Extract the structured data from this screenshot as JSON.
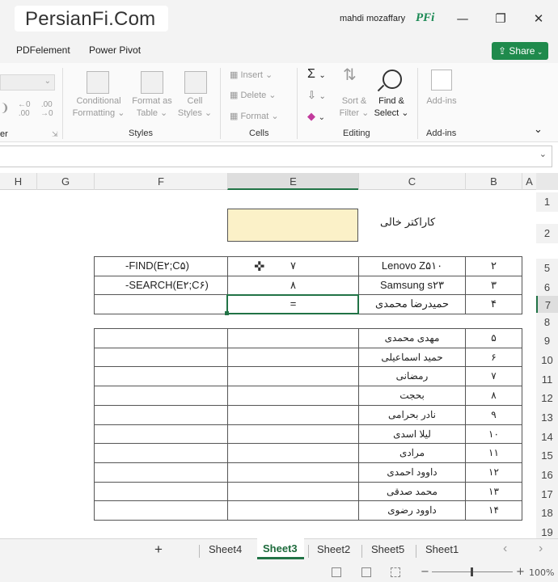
{
  "brand": {
    "logo_text": "PersianFi.Com",
    "user_name": "mahdi mozaffary",
    "user_initials": "PFi"
  },
  "window": {
    "minimize": "—",
    "restore": "❐",
    "close": "✕"
  },
  "ribbon_tabs": [
    "PDFelement",
    "Power Pivot"
  ],
  "share_label": "Share",
  "ribbon": {
    "styles": {
      "conditional_1": "Conditional",
      "conditional_2": "Formatting",
      "format_as_1": "Format as",
      "format_as_2": "Table",
      "cell_1": "Cell",
      "cell_2": "Styles",
      "group": "Styles"
    },
    "cells": {
      "insert": "Insert",
      "delete": "Delete",
      "format": "Format",
      "group": "Cells"
    },
    "editing": {
      "sort_1": "Sort &",
      "sort_2": "Filter",
      "find_1": "Find &",
      "find_2": "Select",
      "group": "Editing"
    },
    "addins": {
      "label": "Add-ins",
      "group": "Add-ins"
    },
    "left_group_fragment": "er"
  },
  "columns": [
    "H",
    "G",
    "F",
    "E",
    "C",
    "B",
    "A"
  ],
  "rows": [
    "1",
    "2",
    "5",
    "6",
    "7",
    "8",
    "9",
    "10",
    "11",
    "12",
    "13",
    "14",
    "15",
    "16",
    "17",
    "18",
    "19"
  ],
  "sheet": {
    "label_cell": "کاراکتر خالی",
    "top_rows": [
      {
        "n": "۲",
        "c": "Lenovo Z۵۱۰",
        "e": "۷",
        "f": "-FIND(E۲;C۵)"
      },
      {
        "n": "۳",
        "c": "Samsung s۲۳",
        "e": "۸",
        "f": "-SEARCH(E۲;C۶)"
      },
      {
        "n": "۴",
        "c": "حمیدرضا محمدی",
        "e": "=",
        "f": ""
      }
    ],
    "list_rows": [
      {
        "n": "۵",
        "c": "مهدی محمدی"
      },
      {
        "n": "۶",
        "c": "حمید اسماعیلی"
      },
      {
        "n": "۷",
        "c": "رمضانی"
      },
      {
        "n": "۸",
        "c": "بحجت"
      },
      {
        "n": "۹",
        "c": "نادر بحرامی"
      },
      {
        "n": "۱۰",
        "c": "لیلا اسدی"
      },
      {
        "n": "۱۱",
        "c": "مرادی"
      },
      {
        "n": "۱۲",
        "c": "داوود احمدی"
      },
      {
        "n": "۱۳",
        "c": "محمد صدقی"
      },
      {
        "n": "۱۴",
        "c": "داوود رضوی"
      }
    ]
  },
  "sheet_tabs": {
    "add": "+",
    "tabs": [
      "Sheet4",
      "Sheet3",
      "Sheet2",
      "Sheet5",
      "Sheet1"
    ],
    "active": "Sheet3"
  },
  "status": {
    "zoom": "100%"
  },
  "colors": {
    "accent_green": "#1f8a4c",
    "highlight_cell": "#fbf1c8"
  }
}
